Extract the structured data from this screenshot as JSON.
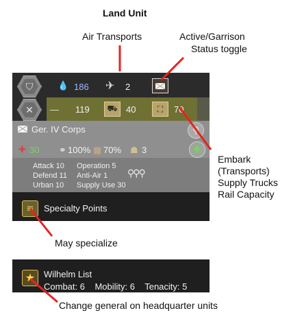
{
  "labels": {
    "title": "Land Unit",
    "air_transports": "Air Transports",
    "active_line1": "Active/Garrison",
    "active_line2": "Status toggle",
    "embark_line1": "Embark",
    "embark_line2": "(Transports)",
    "embark_line3": "Supply Trucks",
    "embark_line4": "Rail Capacity",
    "may_specialize": "May specialize",
    "change_general": "Change general on headquarter units"
  },
  "unit": {
    "fuel": "186",
    "air": "2",
    "transports": "119",
    "trucks": "40",
    "rail": "70",
    "name": "Ger. IV Corps",
    "strength": "30",
    "org": "100%",
    "supply": "70%",
    "men": "3",
    "attack_label": "Attack",
    "attack": "10",
    "operation_label": "Operation",
    "operation": "5",
    "defend_label": "Defend",
    "defend": "11",
    "antiair_label": "Anti-Air",
    "antiair": "1",
    "urban_label": "Urban",
    "urban": "10",
    "supplyuse_label": "Supply Use",
    "supplyuse": "30",
    "specialty": "Specialty Points"
  },
  "general": {
    "name": "Wilhelm List",
    "combat_label": "Combat:",
    "combat": "6",
    "mobility_label": "Mobility:",
    "mobility": "6",
    "tenacity_label": "Tenacity:",
    "tenacity": "5"
  },
  "icons": {
    "fuel": "drop-icon",
    "air": "plane-icon",
    "transports": "ship-icon",
    "trucks": "truck-icon",
    "rail": "rail-icon",
    "status": "envelope-icon",
    "zoom": "magnifier-icon",
    "add": "plus-icon",
    "general": "star-icon",
    "specialty": "chevron-rank-icon"
  },
  "colors": {
    "arrow": "#e8231f",
    "strength": "#7cd35a",
    "fuel_text": "#9fb8ff"
  }
}
